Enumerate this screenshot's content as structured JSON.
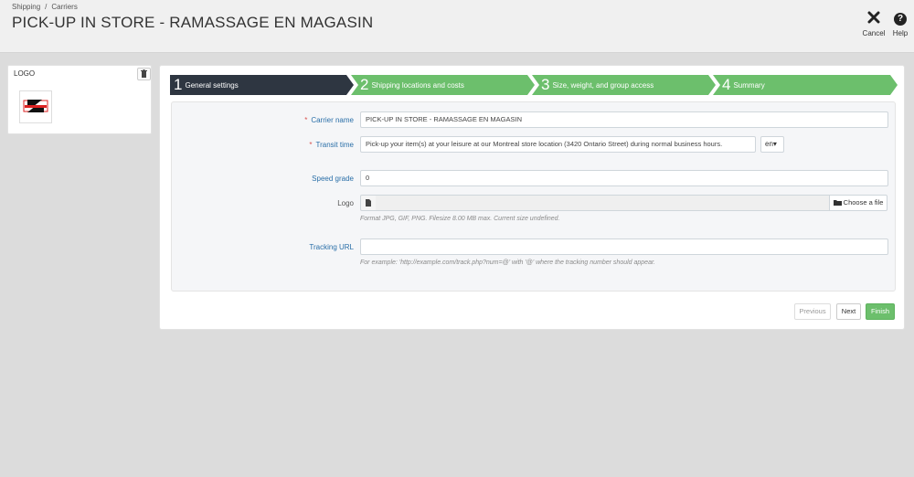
{
  "breadcrumb": {
    "parent": "Shipping",
    "separator": "/",
    "current": "Carriers"
  },
  "page_title": "PICK-UP IN STORE - RAMASSAGE EN MAGASIN",
  "toolbar": {
    "cancel_label": "Cancel",
    "help_label": "Help",
    "cancel_icon": "close-icon",
    "help_icon": "question-icon"
  },
  "logo_panel": {
    "heading": "LOGO"
  },
  "wizard": {
    "steps": [
      {
        "number": "1",
        "label": "General settings",
        "state": "active"
      },
      {
        "number": "2",
        "label": "Shipping locations and costs",
        "state": "todo"
      },
      {
        "number": "3",
        "label": "Size, weight, and group access",
        "state": "todo"
      },
      {
        "number": "4",
        "label": "Summary",
        "state": "todo"
      }
    ],
    "active_color": "#2e3641",
    "todo_color": "#6cbf6c"
  },
  "form": {
    "carrier_name": {
      "label": "Carrier name",
      "required": "*",
      "value": "PICK-UP IN STORE - RAMASSAGE EN MAGASIN"
    },
    "transit_time": {
      "label": "Transit time",
      "required": "*",
      "value": "Pick-up your item(s) at your leisure at our Montreal store location (3420 Ontario Street) during normal business hours.",
      "lang": "en",
      "lang_caret": "▾"
    },
    "speed_grade": {
      "label": "Speed grade",
      "value": "0"
    },
    "logo": {
      "label": "Logo",
      "choose_label": "Choose a file",
      "help": "Format JPG, GIF, PNG. Filesize 8.00 MB max. Current size undefined."
    },
    "tracking_url": {
      "label": "Tracking URL",
      "value": "",
      "help": "For example: 'http://example.com/track.php?num=@' with '@' where the tracking number should appear."
    }
  },
  "footer": {
    "previous_label": "Previous",
    "next_label": "Next",
    "finish_label": "Finish"
  }
}
